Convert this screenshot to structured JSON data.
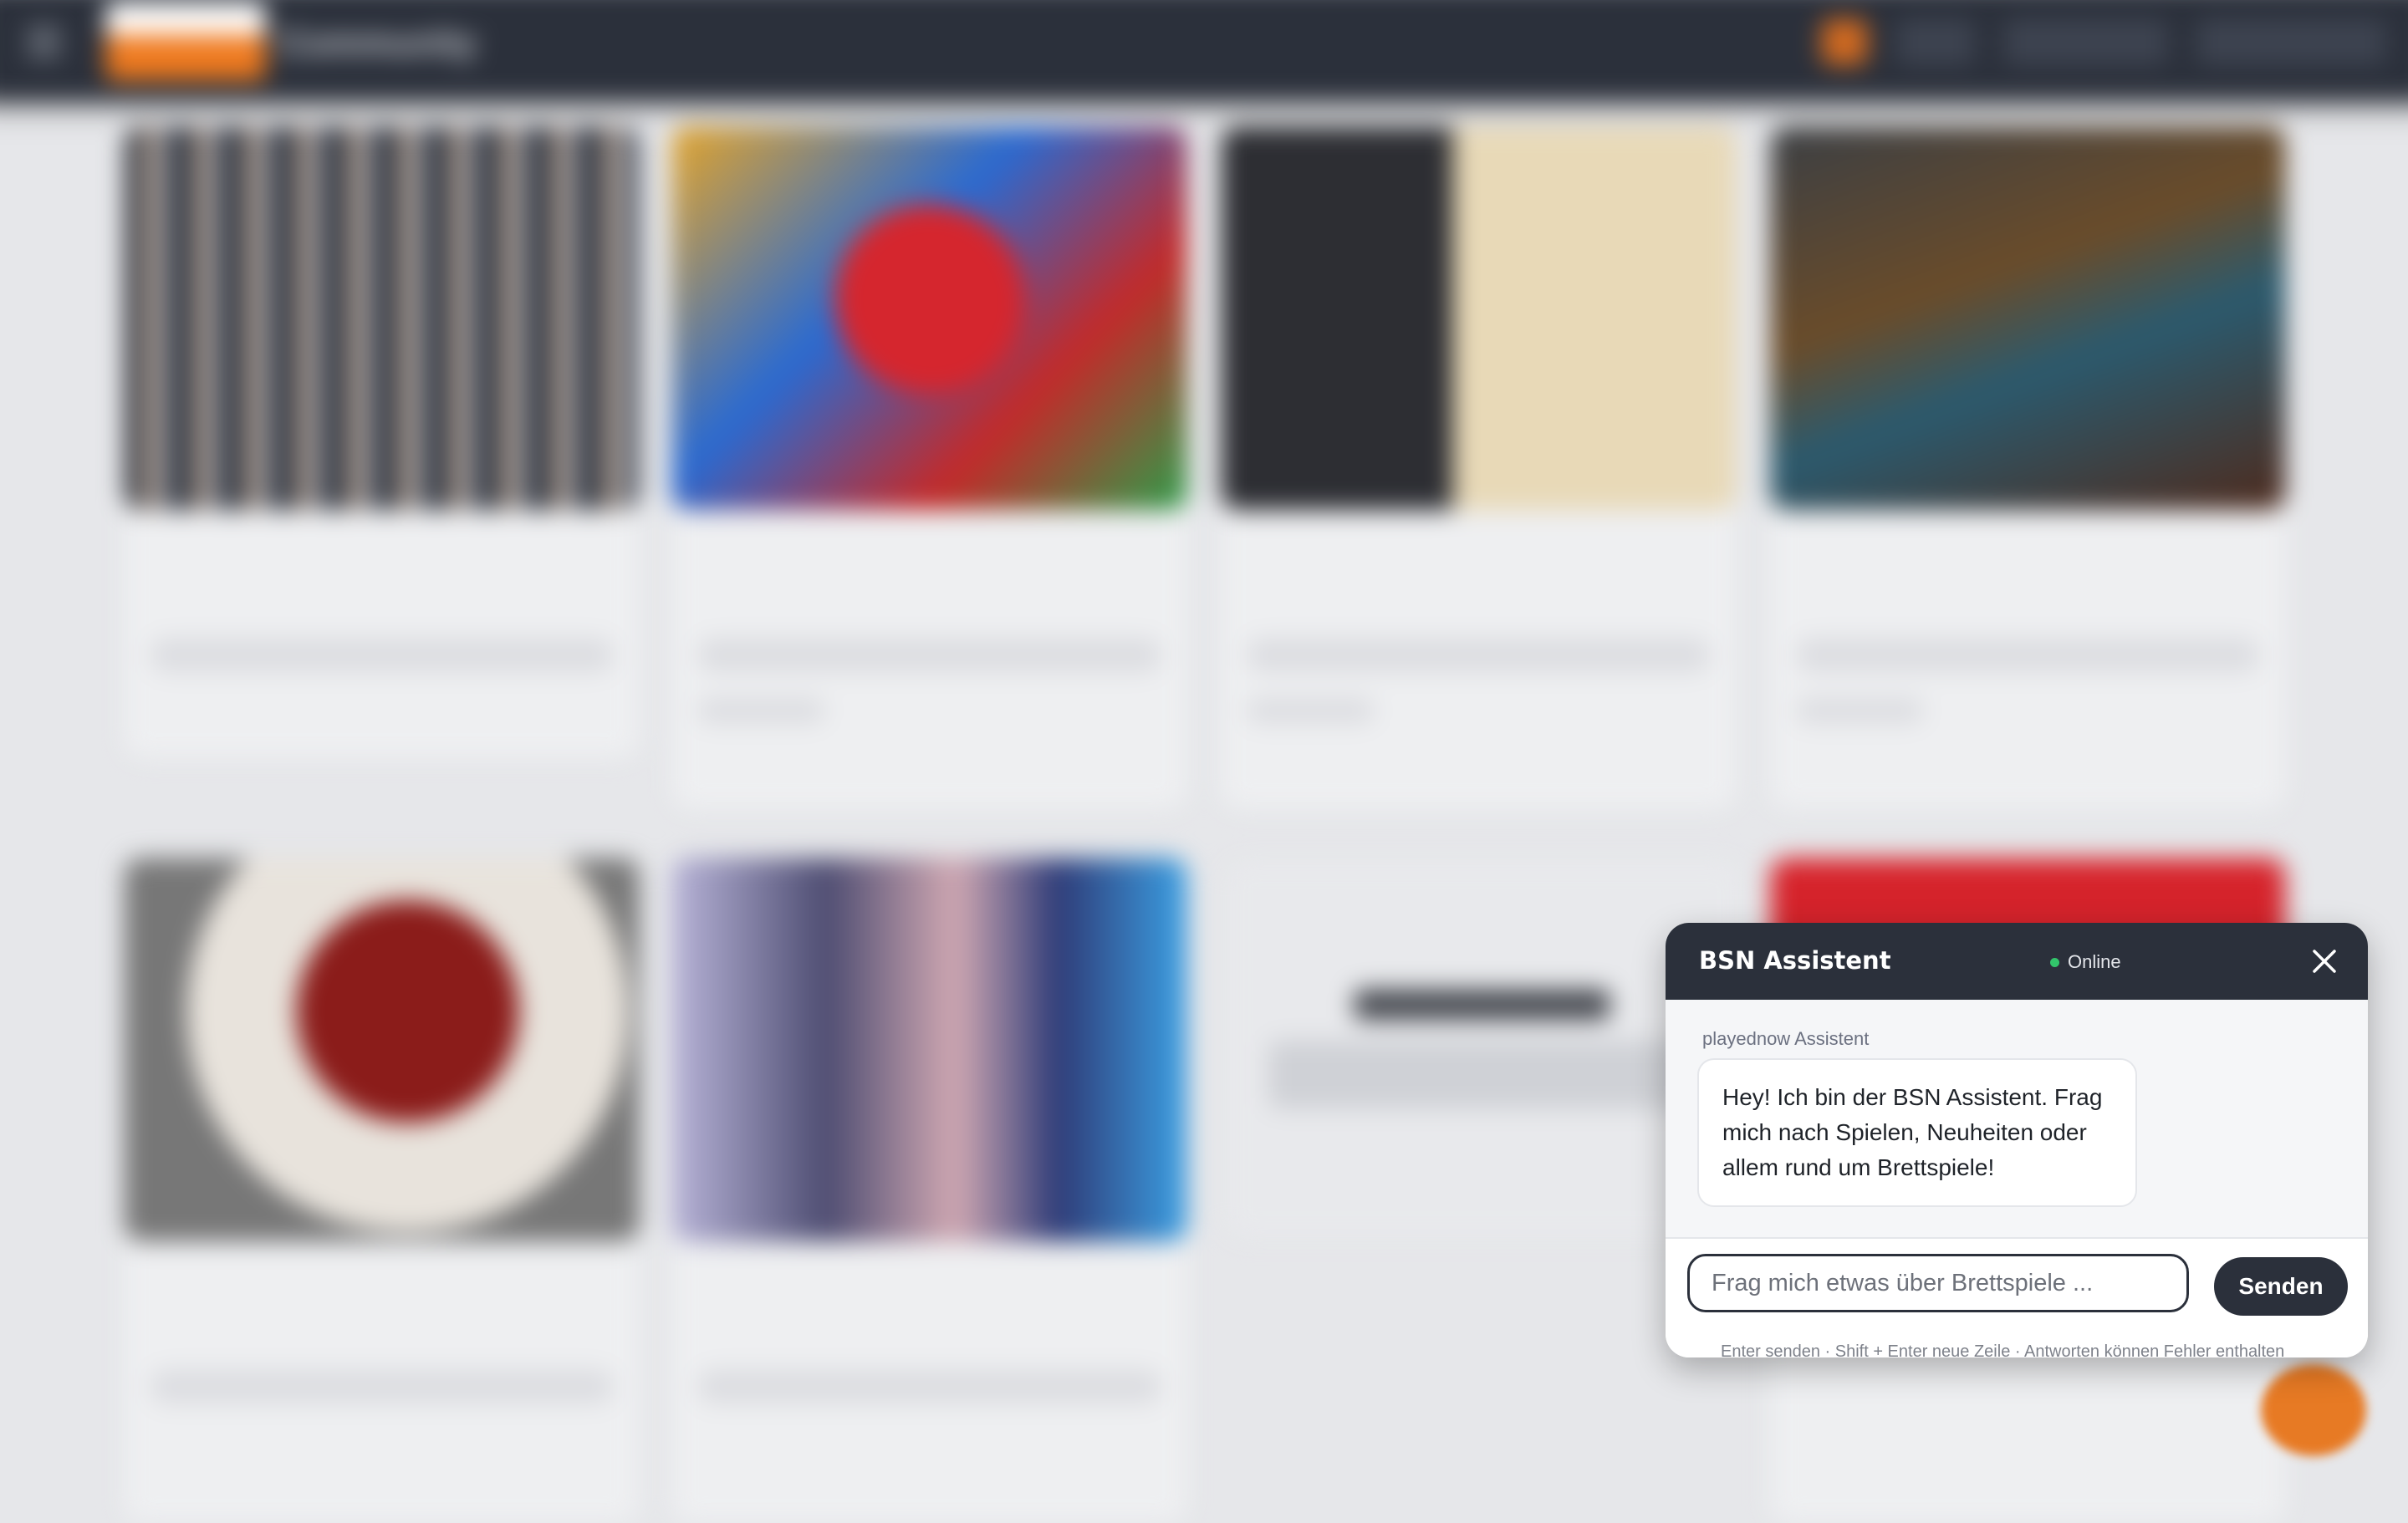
{
  "topbar": {
    "community_label": "Community"
  },
  "chat": {
    "title": "BSN Assistent",
    "status": "Online",
    "sender": "playednow Assistent",
    "message": "Hey! Ich bin der BSN Assistent. Frag mich nach Spielen, Neuheiten oder allem rund um Brettspiele!",
    "input_placeholder": "Frag mich etwas über Brettspiele ...",
    "input_value": "",
    "send_label": "Senden",
    "hint": "Enter senden · Shift + Enter neue Zeile · Antworten können Fehler enthalten",
    "colors": {
      "header": "#2b303b",
      "status_dot": "#32c56b",
      "accent": "#e77a24"
    }
  }
}
